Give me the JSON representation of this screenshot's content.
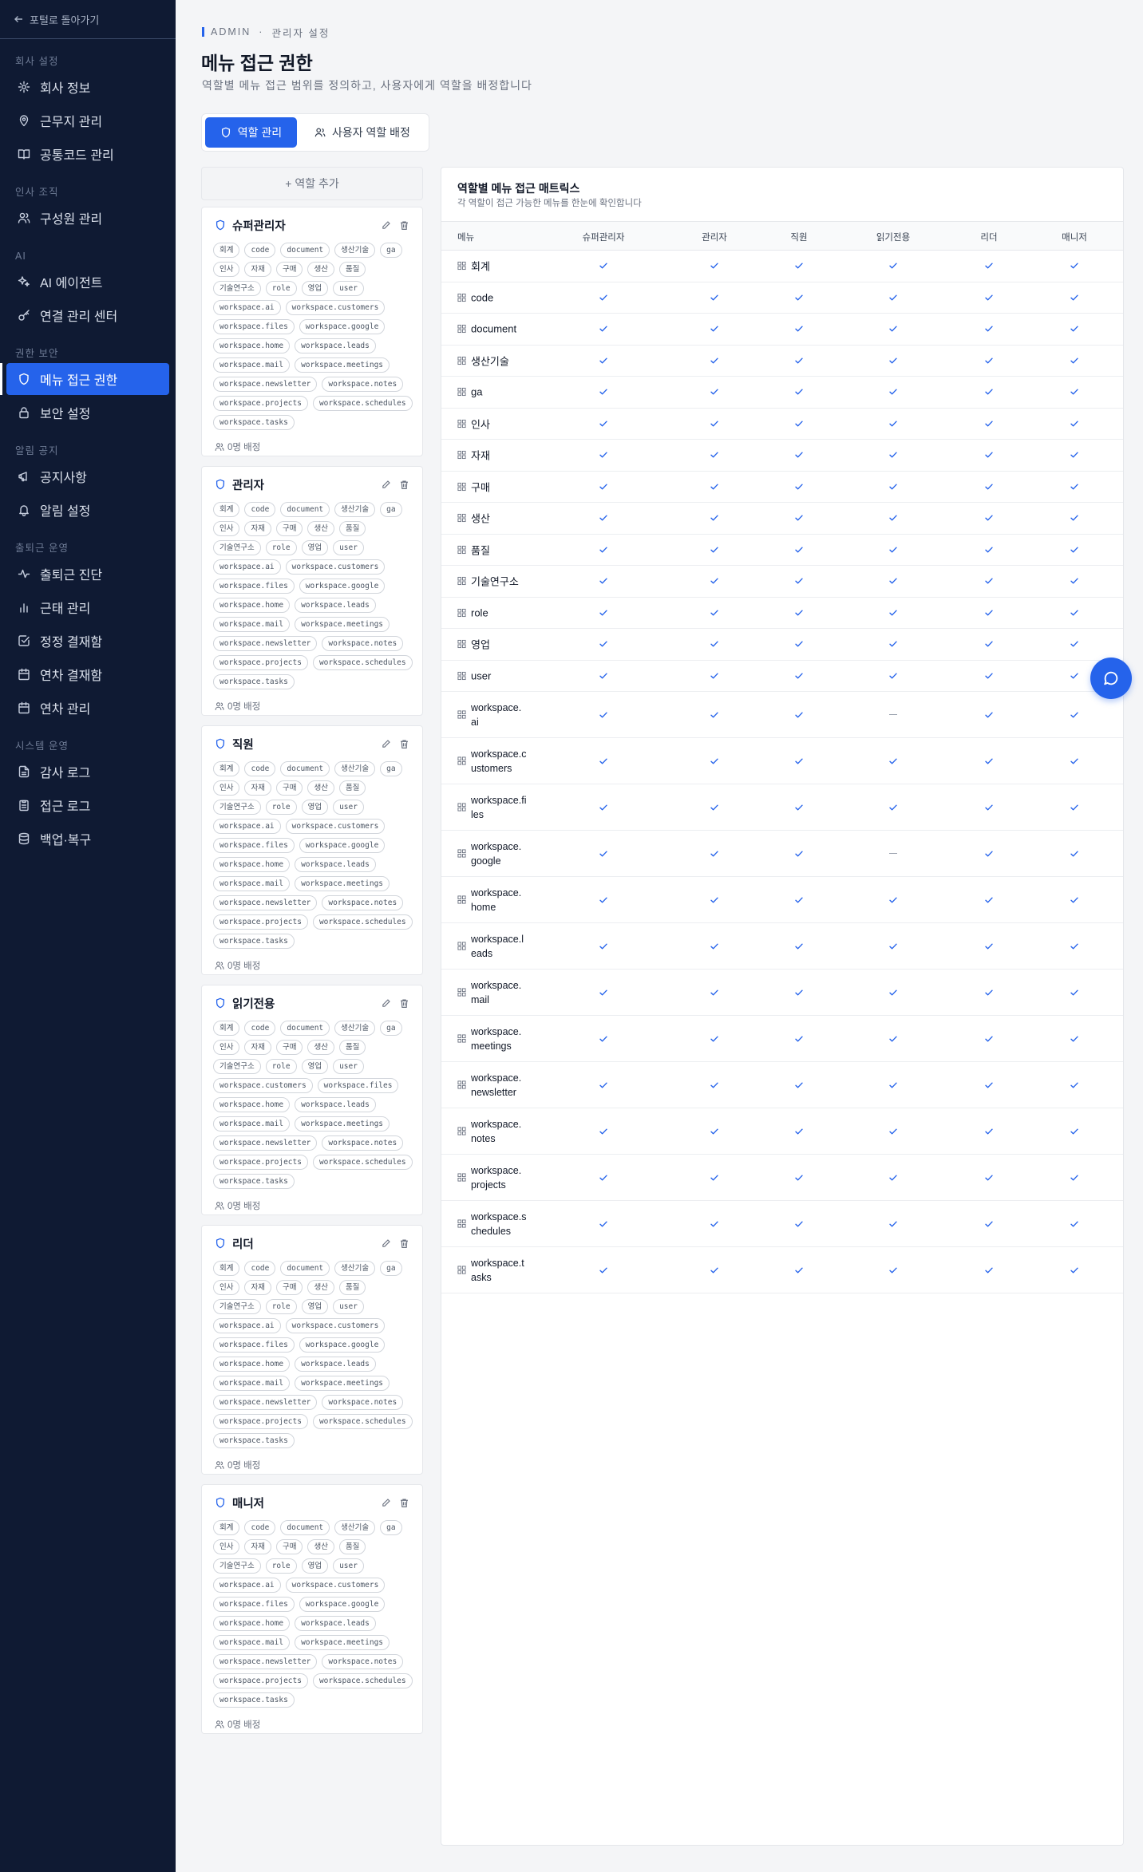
{
  "sidebar": {
    "back_label": "포털로 돌아가기",
    "sections": [
      {
        "title": "회사 설정",
        "items": [
          {
            "label": "회사 정보",
            "icon": "gear-icon"
          },
          {
            "label": "근무지 관리",
            "icon": "map-pin-icon"
          },
          {
            "label": "공통코드 관리",
            "icon": "book-icon"
          }
        ]
      },
      {
        "title": "인사 조직",
        "items": [
          {
            "label": "구성원 관리",
            "icon": "users-icon"
          }
        ]
      },
      {
        "title": "AI",
        "items": [
          {
            "label": "AI 에이전트",
            "icon": "sparkle-icon"
          },
          {
            "label": "연결 관리 센터",
            "icon": "key-icon"
          }
        ]
      },
      {
        "title": "권한 보안",
        "items": [
          {
            "label": "메뉴 접근 권한",
            "icon": "shield-icon",
            "active": true
          },
          {
            "label": "보안 설정",
            "icon": "lock-icon"
          }
        ]
      },
      {
        "title": "알림 공지",
        "items": [
          {
            "label": "공지사항",
            "icon": "megaphone-icon"
          },
          {
            "label": "알림 설정",
            "icon": "bell-icon"
          }
        ]
      },
      {
        "title": "출퇴근 운영",
        "items": [
          {
            "label": "출퇴근 진단",
            "icon": "activity-icon"
          },
          {
            "label": "근태 관리",
            "icon": "bar-chart-icon"
          },
          {
            "label": "정정 결재함",
            "icon": "check-square-icon"
          },
          {
            "label": "연차 결재함",
            "icon": "calendar-icon"
          },
          {
            "label": "연차 관리",
            "icon": "calendar-icon"
          }
        ]
      },
      {
        "title": "시스템 운영",
        "items": [
          {
            "label": "감사 로그",
            "icon": "file-text-icon"
          },
          {
            "label": "접근 로그",
            "icon": "clipboard-icon"
          },
          {
            "label": "백업·복구",
            "icon": "database-icon"
          }
        ]
      }
    ]
  },
  "header": {
    "crumb_root": "ADMIN",
    "crumb_sep": "·",
    "crumb_page": "관리자 설정",
    "title": "메뉴 접근 권한",
    "subtitle": "역할별 메뉴 접근 범위를 정의하고, 사용자에게 역할을 배정합니다"
  },
  "tabs": {
    "roles": "역할 관리",
    "assign": "사용자 역할 배정"
  },
  "add_role_label": "+ 역할 추가",
  "role_chips_full": [
    "회계",
    "code",
    "document",
    "생산기술",
    "ga",
    "인사",
    "자재",
    "구매",
    "생산",
    "품질",
    "기술연구소",
    "role",
    "영업",
    "user",
    "workspace.ai",
    "workspace.customers",
    "workspace.files",
    "workspace.google",
    "workspace.home",
    "workspace.leads",
    "workspace.mail",
    "workspace.meetings",
    "workspace.newsletter",
    "workspace.notes",
    "workspace.projects",
    "workspace.schedules",
    "workspace.tasks"
  ],
  "role_chips_readonly": [
    "회계",
    "code",
    "document",
    "생산기술",
    "ga",
    "인사",
    "자재",
    "구매",
    "생산",
    "품질",
    "기술연구소",
    "role",
    "영업",
    "user",
    "workspace.customers",
    "workspace.files",
    "workspace.home",
    "workspace.leads",
    "workspace.mail",
    "workspace.meetings",
    "workspace.newsletter",
    "workspace.notes",
    "workspace.projects",
    "workspace.schedules",
    "workspace.tasks"
  ],
  "roles": [
    {
      "name": "슈퍼관리자",
      "assigned": "0명 배정",
      "chips": "full"
    },
    {
      "name": "관리자",
      "assigned": "0명 배정",
      "chips": "full"
    },
    {
      "name": "직원",
      "assigned": "0명 배정",
      "chips": "full"
    },
    {
      "name": "읽기전용",
      "assigned": "0명 배정",
      "chips": "readonly"
    },
    {
      "name": "리더",
      "assigned": "0명 배정",
      "chips": "full"
    },
    {
      "name": "매니저",
      "assigned": "0명 배정",
      "chips": "full"
    }
  ],
  "matrix": {
    "title": "역할별 메뉴 접근 매트릭스",
    "subtitle": "각 역할이 접근 가능한 메뉴를 한눈에 확인합니다",
    "menu_header": "메뉴",
    "columns": [
      "슈퍼관리자",
      "관리자",
      "직원",
      "읽기전용",
      "리더",
      "매니저"
    ],
    "rows": [
      {
        "menu": "회계",
        "access": [
          1,
          1,
          1,
          1,
          1,
          1
        ]
      },
      {
        "menu": "code",
        "access": [
          1,
          1,
          1,
          1,
          1,
          1
        ]
      },
      {
        "menu": "document",
        "access": [
          1,
          1,
          1,
          1,
          1,
          1
        ]
      },
      {
        "menu": "생산기술",
        "access": [
          1,
          1,
          1,
          1,
          1,
          1
        ]
      },
      {
        "menu": "ga",
        "access": [
          1,
          1,
          1,
          1,
          1,
          1
        ]
      },
      {
        "menu": "인사",
        "access": [
          1,
          1,
          1,
          1,
          1,
          1
        ]
      },
      {
        "menu": "자재",
        "access": [
          1,
          1,
          1,
          1,
          1,
          1
        ]
      },
      {
        "menu": "구매",
        "access": [
          1,
          1,
          1,
          1,
          1,
          1
        ]
      },
      {
        "menu": "생산",
        "access": [
          1,
          1,
          1,
          1,
          1,
          1
        ]
      },
      {
        "menu": "품질",
        "access": [
          1,
          1,
          1,
          1,
          1,
          1
        ]
      },
      {
        "menu": "기술연구소",
        "access": [
          1,
          1,
          1,
          1,
          1,
          1
        ]
      },
      {
        "menu": "role",
        "access": [
          1,
          1,
          1,
          1,
          1,
          1
        ]
      },
      {
        "menu": "영업",
        "access": [
          1,
          1,
          1,
          1,
          1,
          1
        ]
      },
      {
        "menu": "user",
        "access": [
          1,
          1,
          1,
          1,
          1,
          1
        ]
      },
      {
        "menu": "workspace.ai",
        "access": [
          1,
          1,
          1,
          0,
          1,
          1
        ]
      },
      {
        "menu": "workspace.customers",
        "access": [
          1,
          1,
          1,
          1,
          1,
          1
        ]
      },
      {
        "menu": "workspace.files",
        "access": [
          1,
          1,
          1,
          1,
          1,
          1
        ]
      },
      {
        "menu": "workspace.google",
        "access": [
          1,
          1,
          1,
          0,
          1,
          1
        ]
      },
      {
        "menu": "workspace.home",
        "access": [
          1,
          1,
          1,
          1,
          1,
          1
        ]
      },
      {
        "menu": "workspace.leads",
        "access": [
          1,
          1,
          1,
          1,
          1,
          1
        ]
      },
      {
        "menu": "workspace.mail",
        "access": [
          1,
          1,
          1,
          1,
          1,
          1
        ]
      },
      {
        "menu": "workspace.meetings",
        "access": [
          1,
          1,
          1,
          1,
          1,
          1
        ]
      },
      {
        "menu": "workspace.newsletter",
        "access": [
          1,
          1,
          1,
          1,
          1,
          1
        ]
      },
      {
        "menu": "workspace.notes",
        "access": [
          1,
          1,
          1,
          1,
          1,
          1
        ]
      },
      {
        "menu": "workspace.projects",
        "access": [
          1,
          1,
          1,
          1,
          1,
          1
        ]
      },
      {
        "menu": "workspace.schedules",
        "access": [
          1,
          1,
          1,
          1,
          1,
          1
        ]
      },
      {
        "menu": "workspace.tasks",
        "access": [
          1,
          1,
          1,
          1,
          1,
          1
        ]
      }
    ]
  },
  "colors": {
    "accent": "#2563eb",
    "sidebar_bg": "#0f1a33"
  }
}
